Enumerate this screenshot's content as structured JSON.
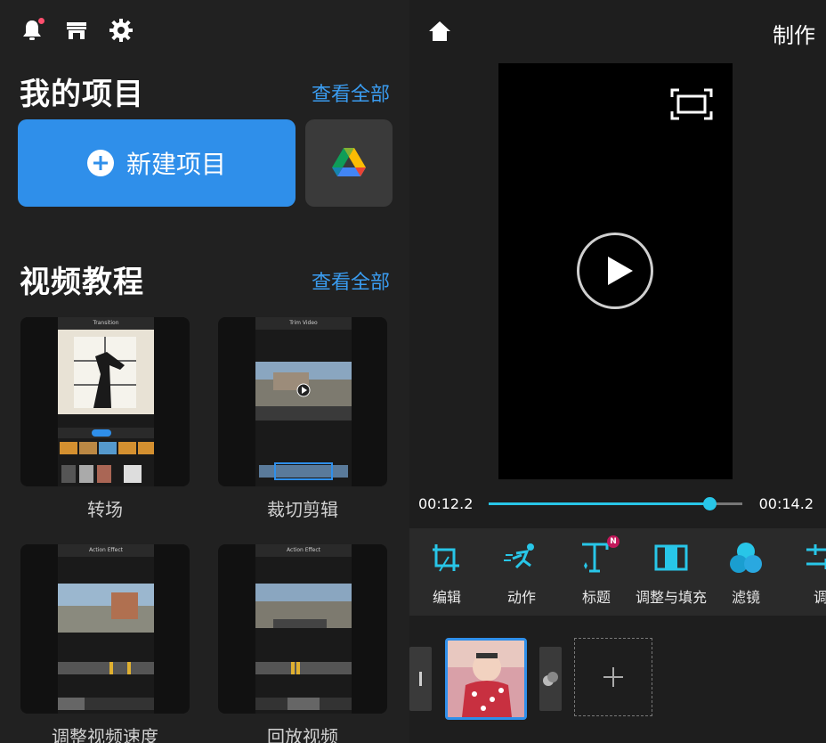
{
  "left": {
    "my_projects": {
      "title": "我的项目",
      "see_all": "查看全部"
    },
    "new_project_label": "新建项目",
    "tutorials": {
      "title": "视频教程",
      "see_all": "查看全部",
      "items": [
        {
          "label": "转场",
          "screen_title": "Transition"
        },
        {
          "label": "裁切剪辑",
          "screen_title": "Trim Video"
        },
        {
          "label": "调整视频速度",
          "screen_title": "Action Effect"
        },
        {
          "label": "回放视频",
          "screen_title": "Action Effect"
        }
      ]
    }
  },
  "right": {
    "title": "制作",
    "time_current": "00:12.2",
    "time_total": "00:14.2",
    "progress": 0.87,
    "tools": [
      {
        "label": "编辑",
        "icon": "edit-crop-icon"
      },
      {
        "label": "动作",
        "icon": "motion-runner-icon"
      },
      {
        "label": "标题",
        "icon": "title-text-icon",
        "badge": "N"
      },
      {
        "label": "调整与填充",
        "icon": "adjust-fill-icon"
      },
      {
        "label": "滤镜",
        "icon": "filter-icon"
      },
      {
        "label": "调",
        "icon": "adjust-sliders-icon"
      }
    ]
  },
  "colors": {
    "accent_blue": "#2f8fea",
    "link_blue": "#3a9cf0",
    "progress_cyan": "#28c6e8",
    "notification_dot": "#ff4f6e"
  }
}
